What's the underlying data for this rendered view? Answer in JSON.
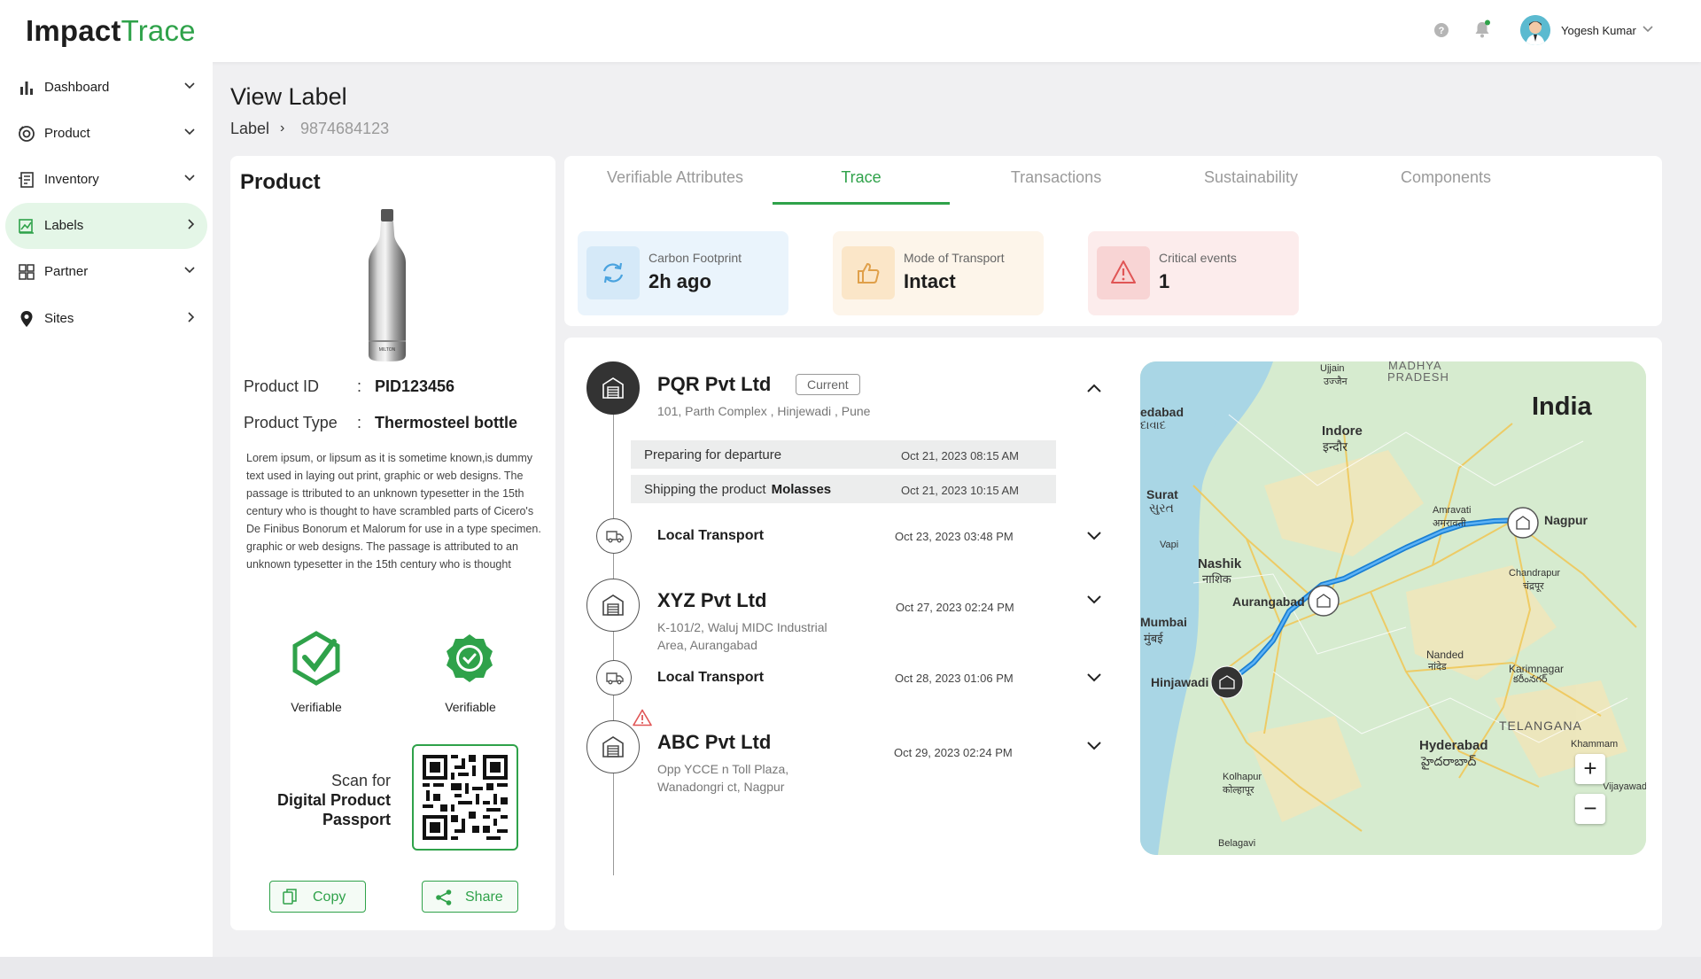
{
  "app": {
    "logo_part1": "Impact",
    "logo_part2": "Trace"
  },
  "header": {
    "user_name": "Yogesh Kumar"
  },
  "sidebar": {
    "items": [
      {
        "label": "Dashboard",
        "icon": "bar-chart-icon"
      },
      {
        "label": "Product",
        "icon": "product-icon"
      },
      {
        "label": "Inventory",
        "icon": "inventory-icon"
      },
      {
        "label": "Labels",
        "icon": "labels-icon",
        "active": true
      },
      {
        "label": "Partner",
        "icon": "partner-icon"
      },
      {
        "label": "Sites",
        "icon": "location-pin-icon"
      }
    ]
  },
  "page": {
    "title": "View Label",
    "breadcrumb_root": "Label",
    "breadcrumb_sep": "›",
    "label_id": "9874684123"
  },
  "product": {
    "heading": "Product",
    "id_key": "Product ID",
    "id_colon": ":",
    "id_value": "PID123456",
    "type_key": "Product Type",
    "type_colon": ":",
    "type_value": "Thermosteel bottle",
    "description": "Lorem ipsum, or lipsum as it is sometime known,is dummy text used in laying out print, graphic or web designs. The passage is ttributed to an unknown typesetter in the 15th century who is thought to have scrambled parts of Cicero's De Finibus Bonorum et Malorum for use in a type specimen. graphic or web designs. The passage is attributed to an unknown typesetter in the 15th century who is thought",
    "badge1": "Verifiable",
    "badge2": "Verifiable",
    "scan_line1": "Scan for",
    "scan_line2": "Digital Product",
    "scan_line3": "Passport",
    "copy_label": "Copy",
    "share_label": "Share"
  },
  "tabs": [
    "Verifiable Attributes",
    "Trace",
    "Transactions",
    "Sustainability",
    "Components"
  ],
  "active_tab": "Trace",
  "stats": [
    {
      "label": "Carbon Footprint",
      "value": "2h ago",
      "icon": "refresh-icon",
      "bg": "#eaf4fc",
      "accent": "#4aa3df"
    },
    {
      "label": "Mode of Transport",
      "value": "Intact",
      "icon": "thumbs-up-icon",
      "bg": "#fdf5ea",
      "accent": "#e0a04a"
    },
    {
      "label": "Critical events",
      "value": "1",
      "icon": "warning-icon",
      "bg": "#fcecec",
      "accent": "#e05555"
    }
  ],
  "trace": {
    "current_tag": "Current",
    "nodes": [
      {
        "name": "PQR Pvt Ltd",
        "address": "101, Parth Complex , Hinjewadi , Pune"
      },
      {
        "sub": "Local Transport",
        "date": "Oct 23, 2023 03:48 PM"
      },
      {
        "name": "XYZ Pvt Ltd",
        "address_line1": "K-101/2, Waluj MIDC Industrial",
        "address_line2": "Area, Aurangabad",
        "date": "Oct 27, 2023 02:24 PM"
      },
      {
        "sub": "Local Transport",
        "date": "Oct 28, 2023 01:06 PM"
      },
      {
        "name": "ABC Pvt Ltd",
        "address_line1": "Opp YCCE n Toll Plaza,",
        "address_line2": "Wanadongri ct, Nagpur",
        "date": "Oct 29, 2023 02:24 PM"
      }
    ],
    "events": [
      {
        "text": "Preparing for departure",
        "bold": "",
        "date": "Oct 21, 2023 08:15 AM"
      },
      {
        "text": "Shipping the product",
        "bold": "Molasses",
        "date": "Oct 21, 2023 10:15 AM"
      }
    ]
  },
  "map": {
    "country": "India",
    "labels": [
      "Ujjain",
      "उज्जैन",
      "MADHYA",
      "PRADESH",
      "edabad",
      "દાવાદ",
      "Indore",
      "इन्दौर",
      "Surat",
      "સુરત",
      "Amravati",
      "अमरावती",
      "Nagpur",
      "Vapi",
      "Nashik",
      "नाशिक",
      "Aurangabad",
      "Chandrapur",
      "चंद्रपूर",
      "Mumbai",
      "मुंबई",
      "Hinjawadi",
      "Nanded",
      "नांदेड",
      "Karimnagar",
      "కరీంనగర్",
      "TELANGANA",
      "Hyderabad",
      "హైదరాబాద్",
      "Khammam",
      "Kolhapur",
      "कोल्हापूर",
      "Vijayawad",
      "Belagavi"
    ],
    "zoom_in": "+",
    "zoom_out": "−"
  }
}
